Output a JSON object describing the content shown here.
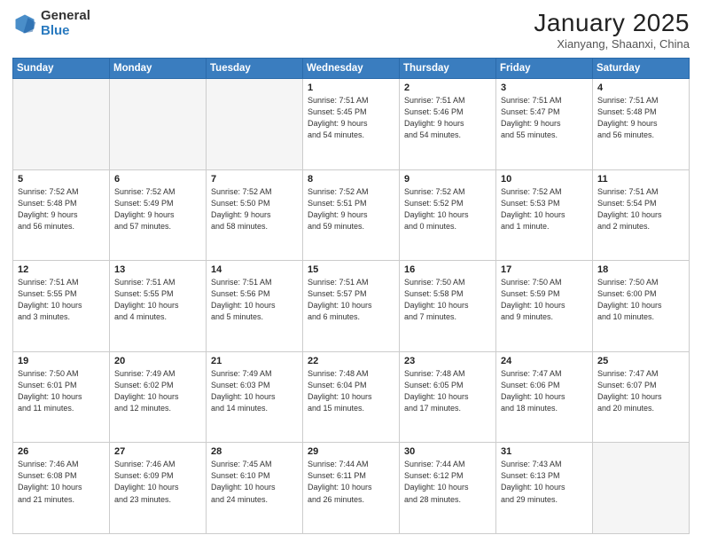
{
  "header": {
    "logo_general": "General",
    "logo_blue": "Blue",
    "title": "January 2025",
    "subtitle": "Xianyang, Shaanxi, China"
  },
  "weekdays": [
    "Sunday",
    "Monday",
    "Tuesday",
    "Wednesday",
    "Thursday",
    "Friday",
    "Saturday"
  ],
  "weeks": [
    [
      {
        "num": "",
        "info": ""
      },
      {
        "num": "",
        "info": ""
      },
      {
        "num": "",
        "info": ""
      },
      {
        "num": "1",
        "info": "Sunrise: 7:51 AM\nSunset: 5:45 PM\nDaylight: 9 hours\nand 54 minutes."
      },
      {
        "num": "2",
        "info": "Sunrise: 7:51 AM\nSunset: 5:46 PM\nDaylight: 9 hours\nand 54 minutes."
      },
      {
        "num": "3",
        "info": "Sunrise: 7:51 AM\nSunset: 5:47 PM\nDaylight: 9 hours\nand 55 minutes."
      },
      {
        "num": "4",
        "info": "Sunrise: 7:51 AM\nSunset: 5:48 PM\nDaylight: 9 hours\nand 56 minutes."
      }
    ],
    [
      {
        "num": "5",
        "info": "Sunrise: 7:52 AM\nSunset: 5:48 PM\nDaylight: 9 hours\nand 56 minutes."
      },
      {
        "num": "6",
        "info": "Sunrise: 7:52 AM\nSunset: 5:49 PM\nDaylight: 9 hours\nand 57 minutes."
      },
      {
        "num": "7",
        "info": "Sunrise: 7:52 AM\nSunset: 5:50 PM\nDaylight: 9 hours\nand 58 minutes."
      },
      {
        "num": "8",
        "info": "Sunrise: 7:52 AM\nSunset: 5:51 PM\nDaylight: 9 hours\nand 59 minutes."
      },
      {
        "num": "9",
        "info": "Sunrise: 7:52 AM\nSunset: 5:52 PM\nDaylight: 10 hours\nand 0 minutes."
      },
      {
        "num": "10",
        "info": "Sunrise: 7:52 AM\nSunset: 5:53 PM\nDaylight: 10 hours\nand 1 minute."
      },
      {
        "num": "11",
        "info": "Sunrise: 7:51 AM\nSunset: 5:54 PM\nDaylight: 10 hours\nand 2 minutes."
      }
    ],
    [
      {
        "num": "12",
        "info": "Sunrise: 7:51 AM\nSunset: 5:55 PM\nDaylight: 10 hours\nand 3 minutes."
      },
      {
        "num": "13",
        "info": "Sunrise: 7:51 AM\nSunset: 5:55 PM\nDaylight: 10 hours\nand 4 minutes."
      },
      {
        "num": "14",
        "info": "Sunrise: 7:51 AM\nSunset: 5:56 PM\nDaylight: 10 hours\nand 5 minutes."
      },
      {
        "num": "15",
        "info": "Sunrise: 7:51 AM\nSunset: 5:57 PM\nDaylight: 10 hours\nand 6 minutes."
      },
      {
        "num": "16",
        "info": "Sunrise: 7:50 AM\nSunset: 5:58 PM\nDaylight: 10 hours\nand 7 minutes."
      },
      {
        "num": "17",
        "info": "Sunrise: 7:50 AM\nSunset: 5:59 PM\nDaylight: 10 hours\nand 9 minutes."
      },
      {
        "num": "18",
        "info": "Sunrise: 7:50 AM\nSunset: 6:00 PM\nDaylight: 10 hours\nand 10 minutes."
      }
    ],
    [
      {
        "num": "19",
        "info": "Sunrise: 7:50 AM\nSunset: 6:01 PM\nDaylight: 10 hours\nand 11 minutes."
      },
      {
        "num": "20",
        "info": "Sunrise: 7:49 AM\nSunset: 6:02 PM\nDaylight: 10 hours\nand 12 minutes."
      },
      {
        "num": "21",
        "info": "Sunrise: 7:49 AM\nSunset: 6:03 PM\nDaylight: 10 hours\nand 14 minutes."
      },
      {
        "num": "22",
        "info": "Sunrise: 7:48 AM\nSunset: 6:04 PM\nDaylight: 10 hours\nand 15 minutes."
      },
      {
        "num": "23",
        "info": "Sunrise: 7:48 AM\nSunset: 6:05 PM\nDaylight: 10 hours\nand 17 minutes."
      },
      {
        "num": "24",
        "info": "Sunrise: 7:47 AM\nSunset: 6:06 PM\nDaylight: 10 hours\nand 18 minutes."
      },
      {
        "num": "25",
        "info": "Sunrise: 7:47 AM\nSunset: 6:07 PM\nDaylight: 10 hours\nand 20 minutes."
      }
    ],
    [
      {
        "num": "26",
        "info": "Sunrise: 7:46 AM\nSunset: 6:08 PM\nDaylight: 10 hours\nand 21 minutes."
      },
      {
        "num": "27",
        "info": "Sunrise: 7:46 AM\nSunset: 6:09 PM\nDaylight: 10 hours\nand 23 minutes."
      },
      {
        "num": "28",
        "info": "Sunrise: 7:45 AM\nSunset: 6:10 PM\nDaylight: 10 hours\nand 24 minutes."
      },
      {
        "num": "29",
        "info": "Sunrise: 7:44 AM\nSunset: 6:11 PM\nDaylight: 10 hours\nand 26 minutes."
      },
      {
        "num": "30",
        "info": "Sunrise: 7:44 AM\nSunset: 6:12 PM\nDaylight: 10 hours\nand 28 minutes."
      },
      {
        "num": "31",
        "info": "Sunrise: 7:43 AM\nSunset: 6:13 PM\nDaylight: 10 hours\nand 29 minutes."
      },
      {
        "num": "",
        "info": ""
      }
    ]
  ]
}
